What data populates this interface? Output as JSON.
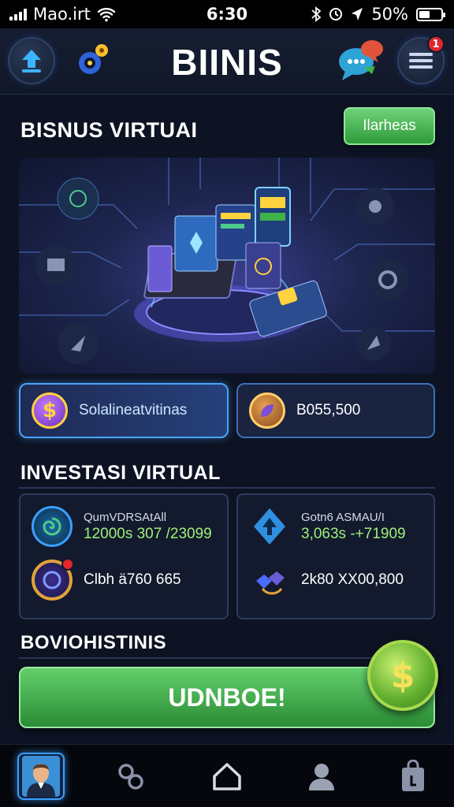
{
  "status_bar": {
    "carrier": "Mao.irt",
    "time": "6:30",
    "battery": "50%",
    "battery_level": 0.5
  },
  "header": {
    "title": "BIINIS",
    "notification_count": "1"
  },
  "business_section": {
    "title": "BISNUS VIRTUAI",
    "filter_label": "Ilarheas"
  },
  "stats": [
    {
      "label": "Solalineatvitinas",
      "icon": "dollar-coin-icon"
    },
    {
      "label": "B055,500",
      "icon": "leaf-coin-icon"
    }
  ],
  "investment_section": {
    "title": "INVESTASI VIRTUAL"
  },
  "investments": [
    {
      "name": "QumVDRSAtAll",
      "value": "12000s 307 /23099"
    },
    {
      "text": "Clbh ä760 665"
    },
    {
      "name": "Gotn6 ASMAU/I",
      "value": "3,063s -+71909"
    },
    {
      "text": "2k80 XX00,800"
    }
  ],
  "cta_section": {
    "title": "BOVIOHISTINIS",
    "button_label": "UDNBOE!"
  },
  "colors": {
    "accent_green": "#3fb24a",
    "accent_blue": "#3aa0ff",
    "gain_text": "#9ff07a",
    "badge_red": "#e0262e"
  }
}
